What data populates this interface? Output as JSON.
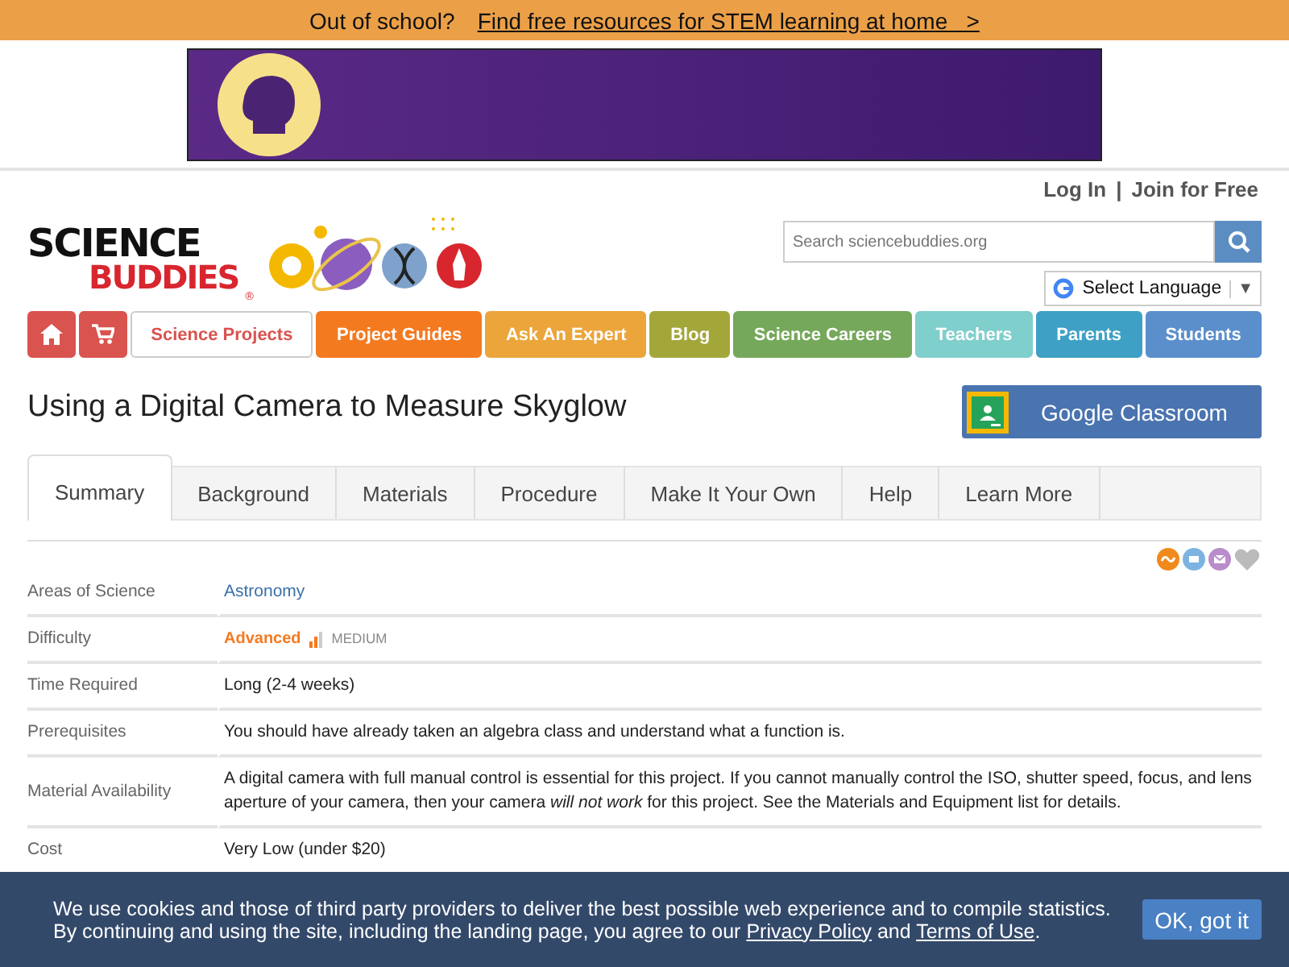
{
  "promo_bar": {
    "text": "Out of school?",
    "link": "Find free resources for STEM learning at home   >"
  },
  "header": {
    "login": "Log In",
    "separator": "|",
    "join": "Join for Free",
    "logo_top": "SCIENCE",
    "logo_bottom": "BUDDIES",
    "logo_mark": "®",
    "search": {
      "placeholder": "Search sciencebuddies.org"
    },
    "language": {
      "label": "Select Language",
      "caret": "▼"
    }
  },
  "nav": [
    {
      "label": "Science Projects",
      "color": "#d9534f",
      "selected": true
    },
    {
      "label": "Project Guides",
      "color": "#f47a20",
      "selected": false
    },
    {
      "label": "Ask An Expert",
      "color": "#eba53b",
      "selected": false
    },
    {
      "label": "Blog",
      "color": "#a3a73a",
      "selected": false
    },
    {
      "label": "Science Careers",
      "color": "#75a85a",
      "selected": false
    },
    {
      "label": "Teachers",
      "color": "#7fcfcc",
      "selected": false
    },
    {
      "label": "Parents",
      "color": "#3ea0c4",
      "selected": false
    },
    {
      "label": "Students",
      "color": "#5a8fcc",
      "selected": false
    }
  ],
  "page_title": "Using a Digital Camera to Measure Skyglow",
  "classroom_button": "Google Classroom",
  "tabs": [
    {
      "label": "Summary",
      "selected": true
    },
    {
      "label": "Background",
      "selected": false
    },
    {
      "label": "Materials",
      "selected": false
    },
    {
      "label": "Procedure",
      "selected": false
    },
    {
      "label": "Make It Your Own",
      "selected": false
    },
    {
      "label": "Help",
      "selected": false
    },
    {
      "label": "Learn More",
      "selected": false
    }
  ],
  "summary": [
    {
      "label": "Areas of Science",
      "kind": "link",
      "value": "Astronomy"
    },
    {
      "label": "Difficulty",
      "kind": "difficulty",
      "value": "Advanced",
      "level_text": "MEDIUM"
    },
    {
      "label": "Time Required",
      "kind": "text",
      "value": "Long (2-4 weeks)"
    },
    {
      "label": "Prerequisites",
      "kind": "text",
      "value": "You should have already taken an algebra class and understand what a function is."
    },
    {
      "label": "Material Availability",
      "kind": "text",
      "value": "A digital camera with full manual control is essential for this project. If you cannot manually control the ISO, shutter speed, focus, and lens aperture of your camera, then your camera *will not work* for this project. See the Materials and Equipment list for details."
    },
    {
      "label": "Cost",
      "kind": "text",
      "value": "Very Low (under $20)"
    }
  ],
  "cookie_banner": {
    "line_1": "We use cookies and those of third party providers to deliver the best possible web experience and to compile statistics.",
    "line_2_start": "By continuing and using the site, including the landing page, you agree to our",
    "privacy_link": "Privacy Policy",
    "and": "and",
    "terms_link": "Terms of Use",
    "end": ".",
    "button": "OK, got it"
  }
}
